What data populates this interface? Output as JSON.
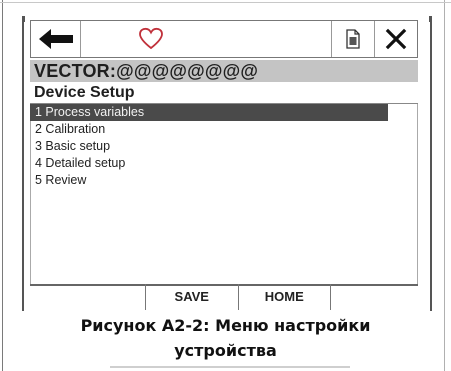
{
  "toolbar": {
    "back_icon": "arrow-left-icon",
    "favorite_icon": "heart-icon",
    "document_icon": "document-icon",
    "close_icon": "close-icon",
    "heart_color": "#c0303a"
  },
  "title": "VECTOR:@@@@@@@@",
  "section": "Device Setup",
  "menu": [
    {
      "label": "1 Process variables",
      "selected": true
    },
    {
      "label": "2 Calibration",
      "selected": false
    },
    {
      "label": "3 Basic setup",
      "selected": false
    },
    {
      "label": "4 Detailed setup",
      "selected": false
    },
    {
      "label": "5 Review",
      "selected": false
    }
  ],
  "softkeys": {
    "save": "SAVE",
    "home": "HOME"
  },
  "caption": {
    "line1": "Рисунок А2-2: Меню настройки",
    "line2": "устройства"
  }
}
